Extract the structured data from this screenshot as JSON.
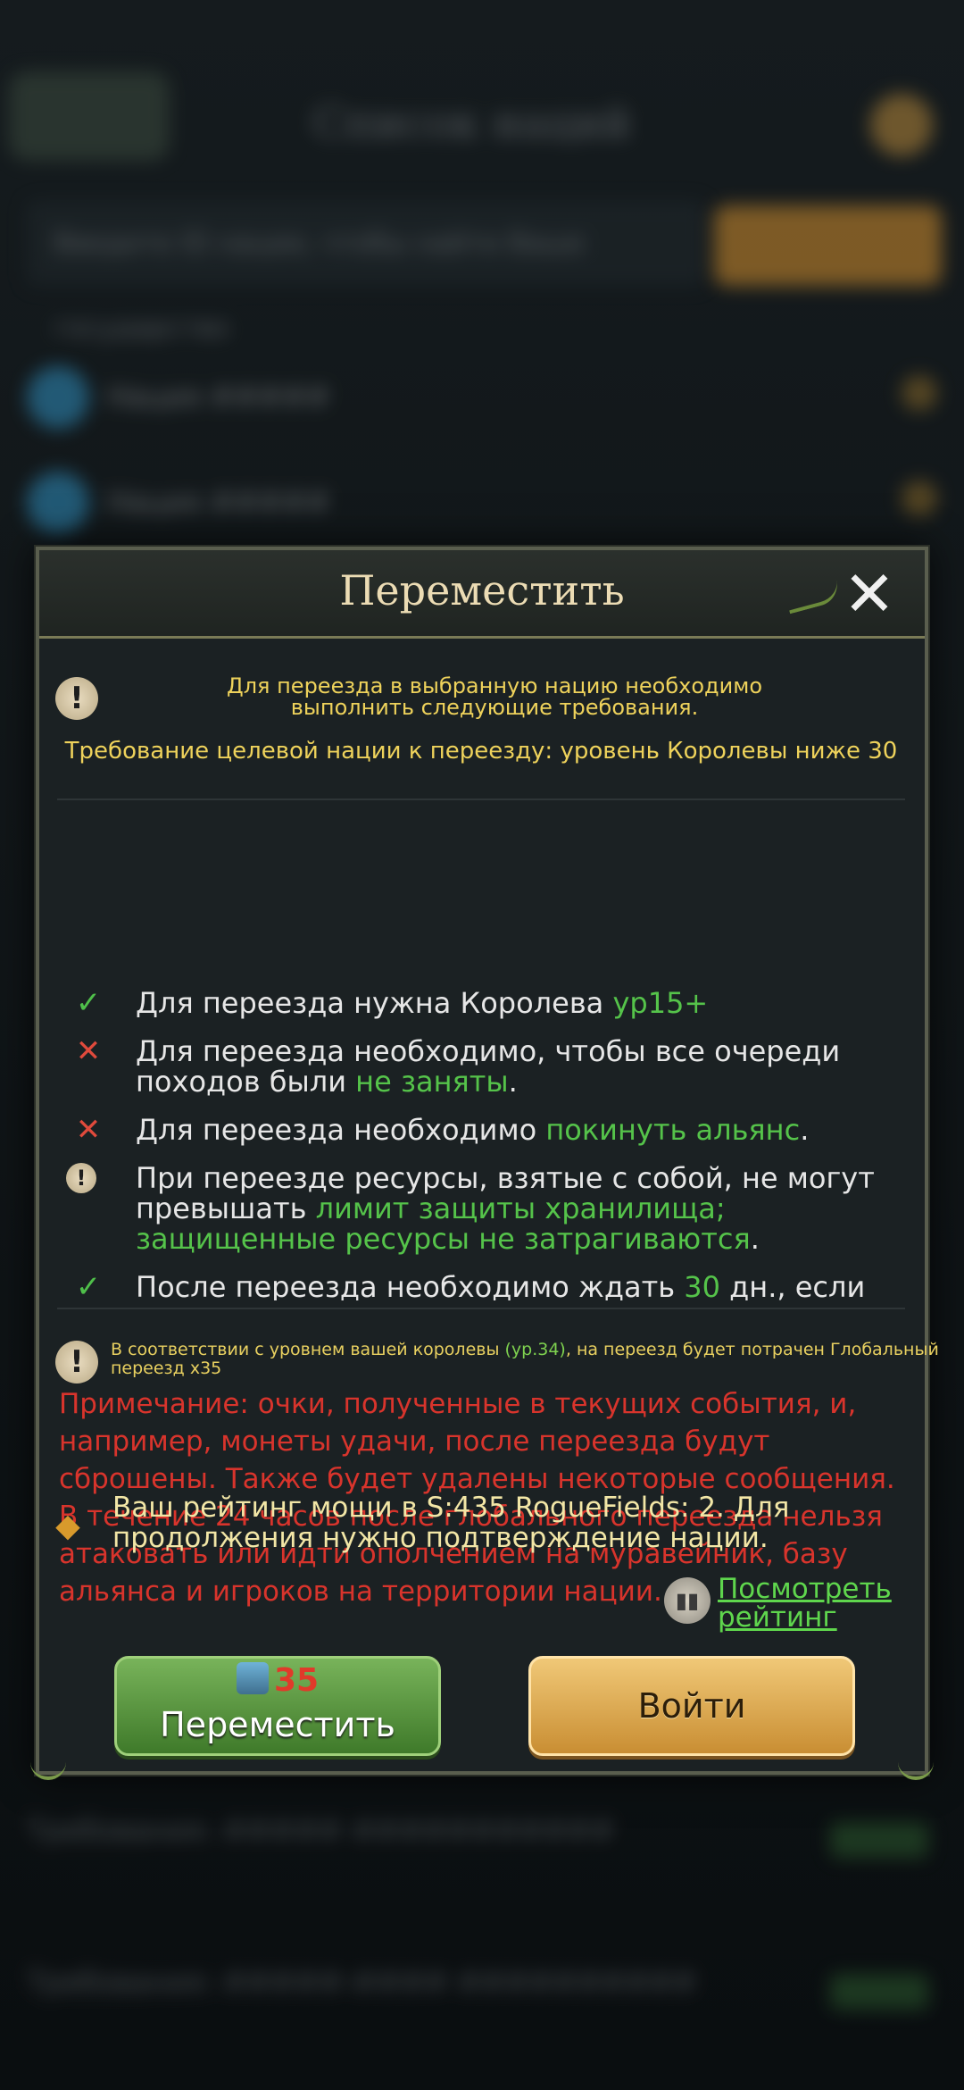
{
  "background": {
    "title": "Список наций",
    "search_placeholder": "Введите ID нации, чтобы найти Ваше государство",
    "rows": [
      "Нация #####",
      "Нация #####"
    ],
    "bottom_rows": [
      "Требования: ##### ###########",
      "Требования: #####-#### ##########"
    ]
  },
  "dialog": {
    "title": "Переместить",
    "intro": "Для переезда в выбранную нацию необходимо выполнить следующие требования.",
    "target_requirement": "Требование целевой нации к переезду: уровень Королевы ниже 30",
    "requirements": [
      {
        "status": "ok",
        "text": "Для переезда нужна Королева ",
        "highlight": "ур15+",
        "suffix": ""
      },
      {
        "status": "fail",
        "text": "Для переезда необходимо, чтобы все очереди походов были ",
        "highlight": "не заняты",
        "suffix": "."
      },
      {
        "status": "fail",
        "text": "Для переезда необходимо ",
        "highlight": "покинуть альянс",
        "suffix": "."
      },
      {
        "status": "info",
        "text": "При переезде ресурсы, взятые с собой, не могут превышать ",
        "highlight": "лимит защиты хранилища; защищенные ресурсы не затрагиваются",
        "suffix": "."
      },
      {
        "status": "ok",
        "text": "После переезда необходимо ждать ",
        "highlight": "30",
        "suffix": " дн., если"
      }
    ],
    "global_note_prefix": "В соответствии с уровнем вашей королевы ",
    "global_note_level": "(ур.34)",
    "global_note_suffix": ", на переезд будет потрачен Глобальный переезд x35",
    "red_note": "Примечание: очки, полученные в текущих события, и, например, монеты удачи, после переезда будут сброшены. Также будет удалены некоторые сообщения. В течение 24 часов после глобального переезда нельзя атаковать или идти ополчением на муравейник, базу альянса и игроков на территории нации.",
    "rating_text": "Ваш рейтинг мощи в S:435 RogueFields: 2. Для продолжения нужно подтверждение нации.",
    "view_rating": "Посмотреть рейтинг",
    "move_cost": "35",
    "move_button": "Переместить",
    "enter_button": "Войти"
  },
  "colors": {
    "accent_green": "#55c34a",
    "error_red": "#e04a3c",
    "note_red": "#d8342c",
    "notice_yellow": "#eed25b"
  },
  "icons": {
    "close": "close-icon",
    "warning": "exclamation-icon",
    "check": "check-icon",
    "cross": "cross-icon",
    "rating": "rating-chart-icon",
    "global_move": "global-move-icon"
  }
}
